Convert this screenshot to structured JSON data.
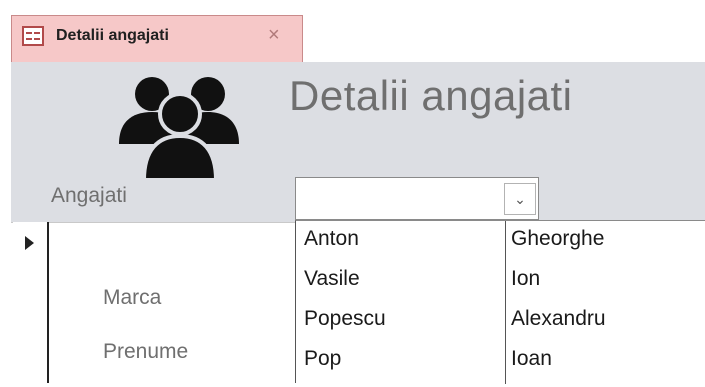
{
  "tab": {
    "title": "Detalii angajati",
    "close_glyph": "×",
    "icon": "form-icon"
  },
  "header": {
    "title": "Detalii angajati",
    "logo_icon": "people-group-icon",
    "combo_label": "Angajati",
    "combo_value": "",
    "combo_button_glyph": "⌄"
  },
  "detail": {
    "record_selector_icon": "record-selector-arrow-icon",
    "fields": [
      {
        "label": "Marca"
      },
      {
        "label": "Prenume"
      }
    ]
  },
  "dropdown": {
    "rows": [
      {
        "col1": "Anton",
        "col2": "Gheorghe"
      },
      {
        "col1": "Vasile",
        "col2": "Ion"
      },
      {
        "col1": "Popescu",
        "col2": "Alexandru"
      },
      {
        "col1": "Pop",
        "col2": "Ioan"
      }
    ]
  },
  "colors": {
    "tab_bg": "#f6c8c8",
    "header_bg": "#dcdee3",
    "title_text": "#6f6f6f",
    "icon_accent": "#b14a4a"
  }
}
